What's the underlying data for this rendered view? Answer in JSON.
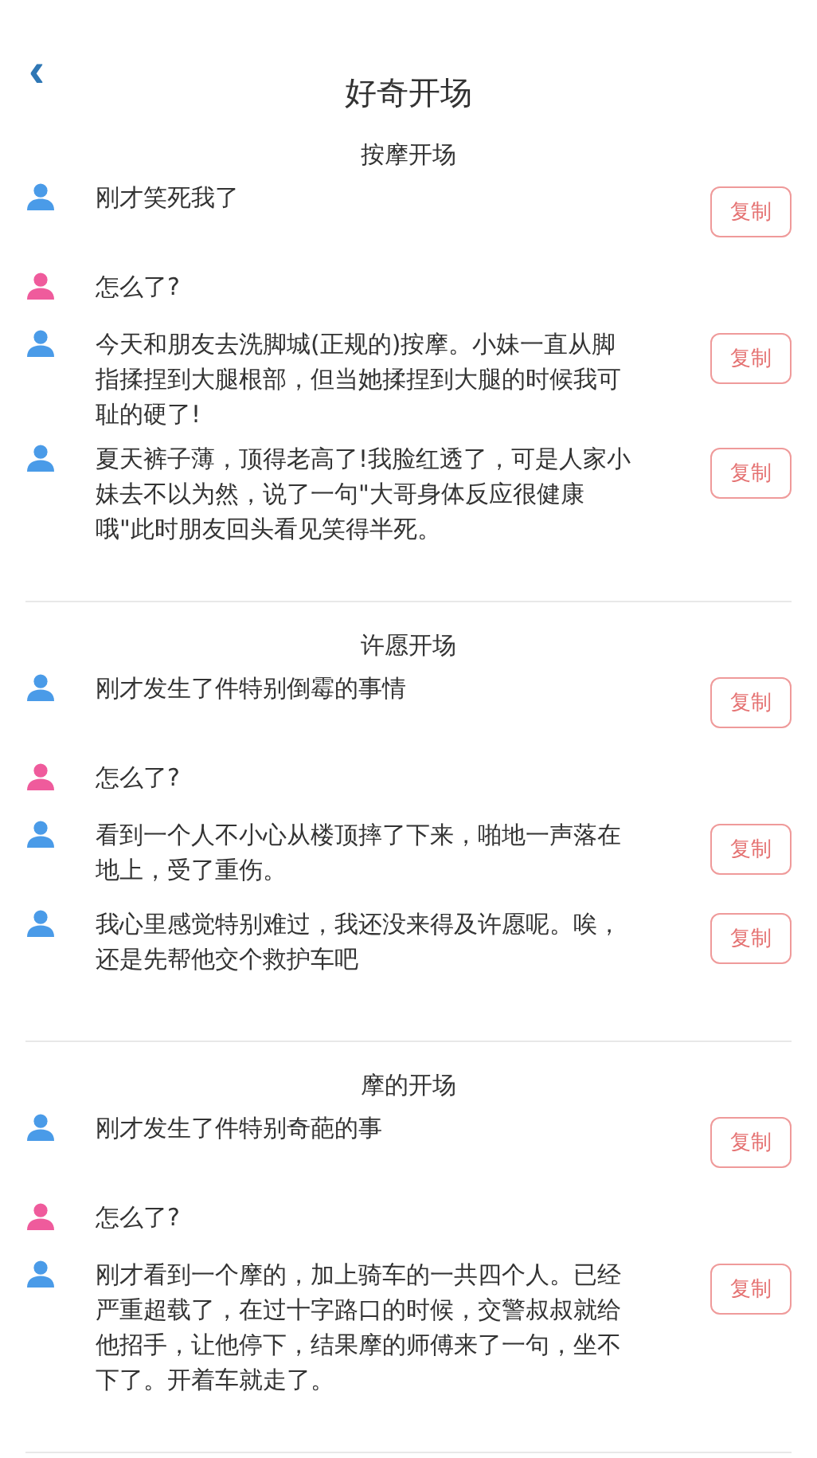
{
  "header": {
    "back_icon": "‹",
    "title": "好奇开场"
  },
  "sections": [
    {
      "title": "按摩开场",
      "messages": [
        {
          "color": "#4a9be8",
          "text": "刚才笑死我了",
          "copy_button": "复制"
        },
        {
          "color": "#ef5b9c",
          "text": "怎么了?"
        },
        {
          "color": "#4a9be8",
          "text": "今天和朋友去洗脚城(正规的)按摩。小妹一直从脚指揉捏到大腿根部，但当她揉捏到大腿的时候我可耻的硬了!",
          "copy_button": "复制"
        },
        {
          "color": "#4a9be8",
          "text": "夏天裤子薄，顶得老高了!我脸红透了，可是人家小妹去不以为然，说了一句\"大哥身体反应很健康哦\"此时朋友回头看见笑得半死。",
          "copy_button": "复制"
        }
      ]
    },
    {
      "title": "许愿开场",
      "messages": [
        {
          "color": "#4a9be8",
          "text": "刚才发生了件特别倒霉的事情",
          "copy_button": "复制"
        },
        {
          "color": "#ef5b9c",
          "text": "怎么了?"
        },
        {
          "color": "#4a9be8",
          "text": "看到一个人不小心从楼顶摔了下来，啪地一声落在地上，受了重伤。",
          "copy_button": "复制"
        },
        {
          "color": "#4a9be8",
          "text": "我心里感觉特别难过，我还没来得及许愿呢。唉，还是先帮他交个救护车吧",
          "copy_button": "复制"
        }
      ]
    },
    {
      "title": "摩的开场",
      "messages": [
        {
          "color": "#4a9be8",
          "text": "刚才发生了件特别奇葩的事",
          "copy_button": "复制"
        },
        {
          "color": "#ef5b9c",
          "text": "怎么了?"
        },
        {
          "color": "#4a9be8",
          "text": "刚才看到一个摩的，加上骑车的一共四个人。已经严重超载了，在过十字路口的时候，交警叔叔就给他招手，让他停下，结果摩的师傅来了一句，坐不下了。开着车就走了。",
          "copy_button": "复制"
        }
      ]
    }
  ]
}
